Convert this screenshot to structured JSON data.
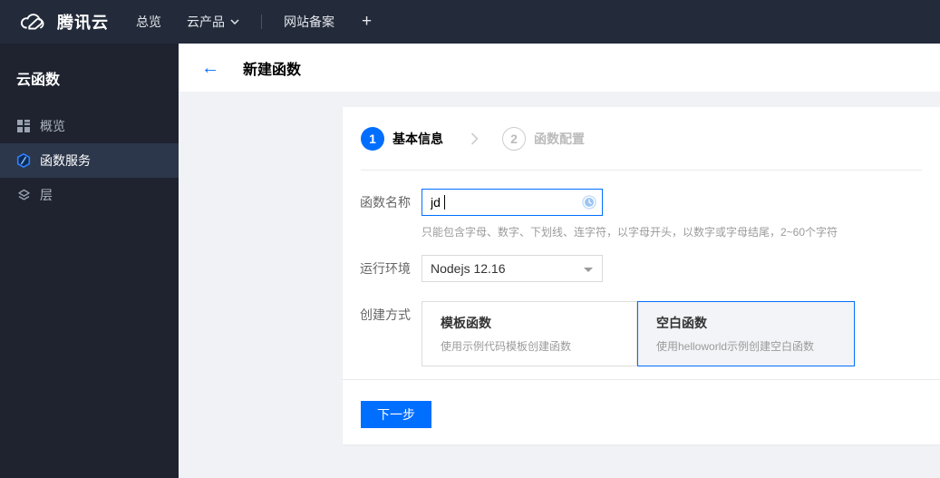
{
  "topnav": {
    "brand": "腾讯云",
    "items": [
      {
        "label": "总览"
      },
      {
        "label": "云产品"
      },
      {
        "label": "网站备案"
      }
    ],
    "plus_label": "+"
  },
  "sidebar": {
    "title": "云函数",
    "items": [
      {
        "label": "概览",
        "icon": "grid-icon",
        "selected": false
      },
      {
        "label": "函数服务",
        "icon": "function-hexagon-icon",
        "selected": true
      },
      {
        "label": "层",
        "icon": "layers-icon",
        "selected": false
      }
    ]
  },
  "header": {
    "back": "←",
    "title": "新建函数"
  },
  "wizard": {
    "steps": [
      {
        "number": "1",
        "label": "基本信息",
        "active": true
      },
      {
        "number": "2",
        "label": "函数配置",
        "active": false
      }
    ],
    "form": {
      "name_label": "函数名称",
      "name_value": "jd",
      "name_help": "只能包含字母、数字、下划线、连字符，以字母开头，以数字或字母结尾，2~60个字符",
      "runtime_label": "运行环境",
      "runtime_value": "Nodejs 12.16",
      "method_label": "创建方式",
      "methods": [
        {
          "title": "模板函数",
          "desc": "使用示例代码模板创建函数",
          "selected": false
        },
        {
          "title": "空白函数",
          "desc": "使用helloworld示例创建空白函数",
          "selected": true
        }
      ]
    },
    "next_button": "下一步"
  },
  "colors": {
    "accent": "#006eff",
    "topnav_bg": "#232b3a",
    "sidebar_bg": "#1e232f",
    "sidebar_selected_bg": "#2c374b",
    "content_bg": "#f1f2f5",
    "inactive_step": "#bbbbbb",
    "selected_card_bg": "#f3f4f7"
  }
}
